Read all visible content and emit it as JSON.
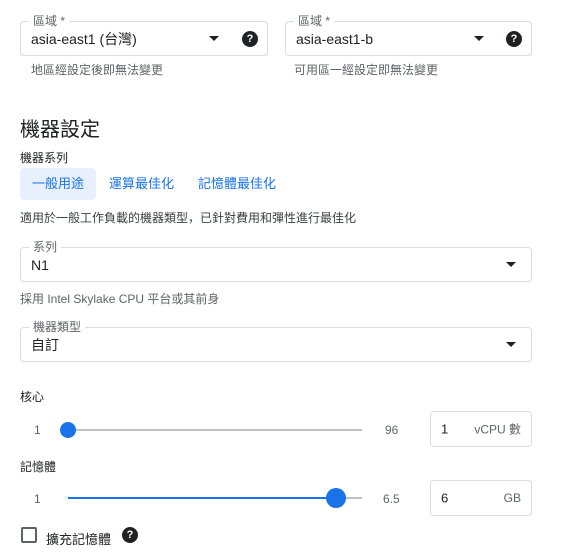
{
  "region": {
    "label": "區域 *",
    "value": "asia-east1 (台灣)",
    "hint": "地區經設定後即無法變更"
  },
  "zone": {
    "label": "區域 *",
    "value": "asia-east1-b",
    "hint": "可用區一經設定即無法變更"
  },
  "section_title": "機器設定",
  "machine_family": {
    "label": "機器系列",
    "tabs": [
      "一般用途",
      "運算最佳化",
      "記憶體最佳化"
    ],
    "active_tab": "一般用途",
    "description": "適用於一般工作負載的機器類型，已針對費用和彈性進行最佳化"
  },
  "series": {
    "label": "系列",
    "value": "N1",
    "hint": "採用 Intel Skylake CPU 平台或其前身"
  },
  "machine_type": {
    "label": "機器類型",
    "value": "自訂"
  },
  "cores": {
    "label": "核心",
    "min": "1",
    "max": "96",
    "value": "1",
    "unit": "vCPU 數",
    "level": 0.0
  },
  "memory": {
    "label": "記憶體",
    "min": "1",
    "max": "6.5",
    "value": "6",
    "unit": "GB",
    "level": 0.91
  },
  "extend_memory": {
    "label": "擴充記憶體",
    "checked": false
  },
  "colors": {
    "accent": "#1a73e8",
    "active_tab_bg": "#e8f0fe",
    "border": "#dadce0",
    "hint": "#5f6368"
  },
  "icons": {
    "dropdown": "caret-down-icon",
    "help": "help-circle-icon"
  }
}
